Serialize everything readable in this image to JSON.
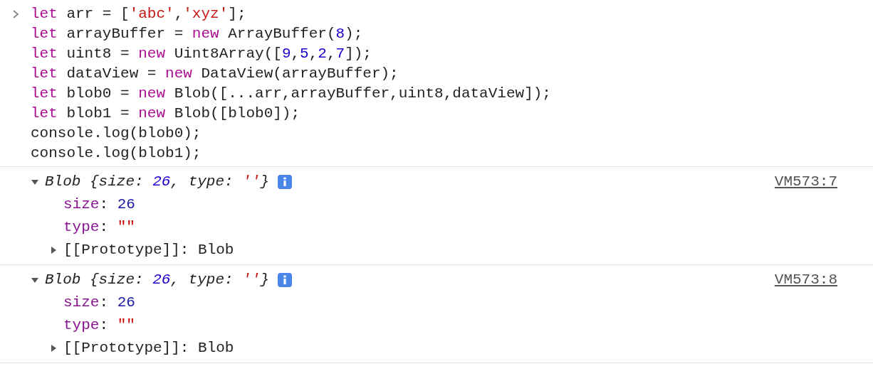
{
  "console": {
    "input": {
      "lines": [
        [
          {
            "kind": "keyword",
            "text": "let"
          },
          {
            "kind": "plain",
            "text": " arr = ["
          },
          {
            "kind": "string",
            "text": "'abc'"
          },
          {
            "kind": "plain",
            "text": ","
          },
          {
            "kind": "string",
            "text": "'xyz'"
          },
          {
            "kind": "plain",
            "text": "];"
          }
        ],
        [
          {
            "kind": "keyword",
            "text": "let"
          },
          {
            "kind": "plain",
            "text": " arrayBuffer = "
          },
          {
            "kind": "keyword",
            "text": "new"
          },
          {
            "kind": "plain",
            "text": " ArrayBuffer("
          },
          {
            "kind": "number",
            "text": "8"
          },
          {
            "kind": "plain",
            "text": ");"
          }
        ],
        [
          {
            "kind": "keyword",
            "text": "let"
          },
          {
            "kind": "plain",
            "text": " uint8 = "
          },
          {
            "kind": "keyword",
            "text": "new"
          },
          {
            "kind": "plain",
            "text": " Uint8Array(["
          },
          {
            "kind": "number",
            "text": "9"
          },
          {
            "kind": "plain",
            "text": ","
          },
          {
            "kind": "number",
            "text": "5"
          },
          {
            "kind": "plain",
            "text": ","
          },
          {
            "kind": "number",
            "text": "2"
          },
          {
            "kind": "plain",
            "text": ","
          },
          {
            "kind": "number",
            "text": "7"
          },
          {
            "kind": "plain",
            "text": "]);"
          }
        ],
        [
          {
            "kind": "keyword",
            "text": "let"
          },
          {
            "kind": "plain",
            "text": " dataView = "
          },
          {
            "kind": "keyword",
            "text": "new"
          },
          {
            "kind": "plain",
            "text": " DataView(arrayBuffer);"
          }
        ],
        [
          {
            "kind": "keyword",
            "text": "let"
          },
          {
            "kind": "plain",
            "text": " blob0 = "
          },
          {
            "kind": "keyword",
            "text": "new"
          },
          {
            "kind": "plain",
            "text": " Blob([...arr,arrayBuffer,uint8,dataView]);"
          }
        ],
        [
          {
            "kind": "keyword",
            "text": "let"
          },
          {
            "kind": "plain",
            "text": " blob1 = "
          },
          {
            "kind": "keyword",
            "text": "new"
          },
          {
            "kind": "plain",
            "text": " Blob([blob0]);"
          }
        ],
        [
          {
            "kind": "plain",
            "text": "console.log(blob0);"
          }
        ],
        [
          {
            "kind": "plain",
            "text": "console.log(blob1);"
          }
        ]
      ]
    },
    "messages": [
      {
        "expanded": true,
        "source": "VM573:7",
        "summary": [
          {
            "kind": "plain",
            "text": "Blob {size: "
          },
          {
            "kind": "number",
            "text": "26"
          },
          {
            "kind": "plain",
            "text": ", type: "
          },
          {
            "kind": "string",
            "text": "''"
          },
          {
            "kind": "plain",
            "text": "}"
          }
        ],
        "properties": [
          {
            "name": "size",
            "separator": ":",
            "value": "26",
            "kind": "number"
          },
          {
            "name": "type",
            "separator": ":",
            "value": "\"\"",
            "kind": "string"
          },
          {
            "name": "[[Prototype]]",
            "separator": ":",
            "value": "Blob",
            "kind": "object",
            "expanded": false
          }
        ]
      },
      {
        "expanded": true,
        "source": "VM573:8",
        "summary": [
          {
            "kind": "plain",
            "text": "Blob {size: "
          },
          {
            "kind": "number",
            "text": "26"
          },
          {
            "kind": "plain",
            "text": ", type: "
          },
          {
            "kind": "string",
            "text": "''"
          },
          {
            "kind": "plain",
            "text": "}"
          }
        ],
        "properties": [
          {
            "name": "size",
            "separator": ":",
            "value": "26",
            "kind": "number"
          },
          {
            "name": "type",
            "separator": ":",
            "value": "\"\"",
            "kind": "string"
          },
          {
            "name": "[[Prototype]]",
            "separator": ":",
            "value": "Blob",
            "kind": "object",
            "expanded": false
          }
        ]
      }
    ]
  }
}
